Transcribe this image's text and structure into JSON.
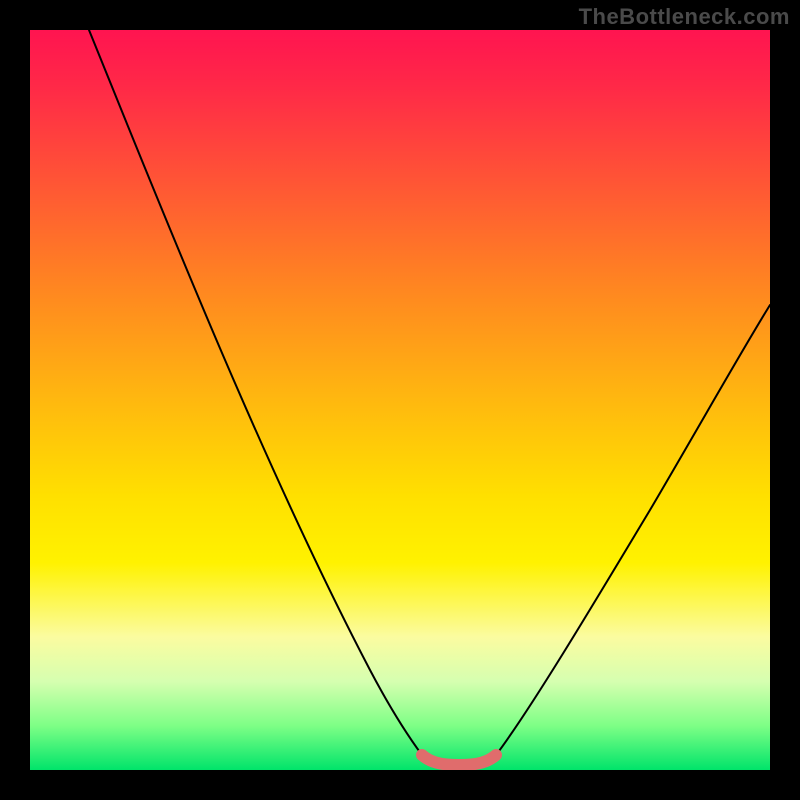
{
  "watermark": "TheBottleneck.com",
  "colors": {
    "frame": "#000000",
    "watermark_text": "#4a4a4a",
    "curve": "#000000",
    "highlight": "#e06c6c",
    "gradient_stops": [
      "#ff1450",
      "#ff2a47",
      "#ff5a33",
      "#ff8a1f",
      "#ffb80f",
      "#ffe000",
      "#fff200",
      "#fbfca0",
      "#d6ffb0",
      "#7eff86",
      "#00e46a"
    ]
  },
  "chart_data": {
    "type": "line",
    "title": "",
    "xlabel": "",
    "ylabel": "",
    "xlim": [
      0,
      100
    ],
    "ylim": [
      0,
      100
    ],
    "note": "Axis values estimated from pixel positions; no tick labels visible.",
    "series": [
      {
        "name": "left-branch",
        "x": [
          8,
          12,
          18,
          24,
          30,
          36,
          42,
          46,
          50,
          53
        ],
        "y": [
          100,
          88,
          74,
          60,
          46,
          33,
          21,
          13,
          6,
          2
        ]
      },
      {
        "name": "right-branch",
        "x": [
          63,
          67,
          72,
          78,
          84,
          90,
          96,
          100
        ],
        "y": [
          2,
          6,
          12,
          21,
          32,
          44,
          56,
          63
        ]
      },
      {
        "name": "trough-highlight",
        "x": [
          53,
          55,
          57,
          59,
          61,
          63
        ],
        "y": [
          2,
          1,
          0.7,
          0.7,
          1,
          2
        ]
      }
    ],
    "background": "red-yellow-green vertical gradient"
  }
}
